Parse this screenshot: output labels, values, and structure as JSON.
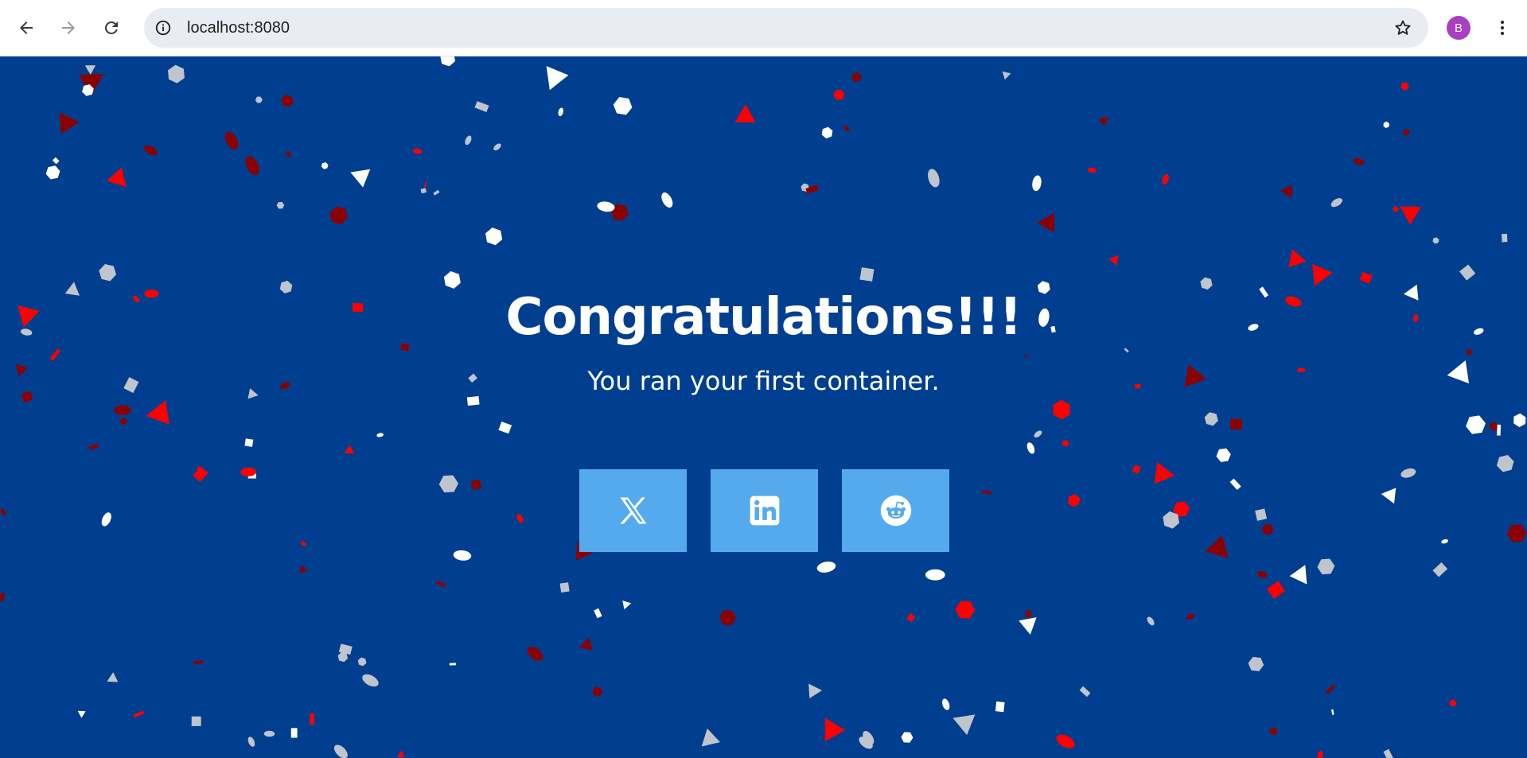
{
  "browser": {
    "url": "localhost:8080",
    "profile_initial": "B",
    "icons": {
      "back": "back-arrow-icon",
      "forward": "forward-arrow-icon",
      "reload": "reload-icon",
      "site_info": "info-icon",
      "bookmark": "star-icon",
      "menu": "kebab-menu-icon"
    },
    "colors": {
      "avatar": "#a93fc1",
      "omnibox": "#e9edf3"
    }
  },
  "page": {
    "headline": "Congratulations!!!",
    "subline": "You ran your first container.",
    "background_color": "#003f8f",
    "share_buttons": [
      {
        "icon": "x-twitter-icon"
      },
      {
        "icon": "linkedin-icon"
      },
      {
        "icon": "reddit-icon"
      }
    ],
    "button_color": "#55aaee",
    "confetti_colors": [
      "#ff0000",
      "#8b0000",
      "#ffffff",
      "#c0c4cc"
    ]
  }
}
